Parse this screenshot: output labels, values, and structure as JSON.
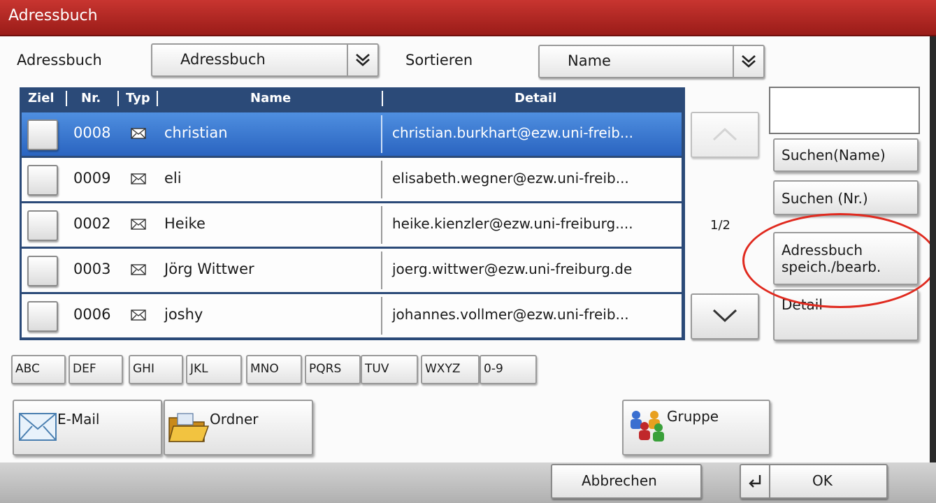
{
  "window": {
    "title": "Adressbuch"
  },
  "toolbar": {
    "addressbook_label": "Adressbuch",
    "addressbook_value": "Adressbuch",
    "sort_label": "Sortieren",
    "sort_value": "Name"
  },
  "list": {
    "headers": {
      "ziel": "Ziel",
      "nr": "Nr.",
      "typ": "Typ",
      "name": "Name",
      "detail": "Detail"
    },
    "rows": [
      {
        "nr": "0008",
        "typ": "email",
        "name": "christian",
        "detail": "christian.burkhart@ezw.uni-freib...",
        "selected": true
      },
      {
        "nr": "0009",
        "typ": "email",
        "name": "eli",
        "detail": "elisabeth.wegner@ezw.uni-freib...",
        "selected": false
      },
      {
        "nr": "0002",
        "typ": "email",
        "name": "Heike",
        "detail": "heike.kienzler@ezw.uni-freiburg....",
        "selected": false
      },
      {
        "nr": "0003",
        "typ": "email",
        "name": "Jörg Wittwer",
        "detail": "joerg.wittwer@ezw.uni-freiburg.de",
        "selected": false
      },
      {
        "nr": "0006",
        "typ": "email",
        "name": "joshy",
        "detail": "johannes.vollmer@ezw.uni-freib...",
        "selected": false
      }
    ],
    "page_indicator": "1/2"
  },
  "side": {
    "search_value": "",
    "search_name": "Suchen(Name)",
    "search_nr": "Suchen (Nr.)",
    "edit_line1": "Adressbuch",
    "edit_line2": "speich./bearb.",
    "detail": "Detail"
  },
  "alpha_keys": [
    "ABC",
    "DEF",
    "GHI",
    "JKL",
    "MNO",
    "PQRS",
    "TUV",
    "WXYZ",
    "0-9"
  ],
  "dest_types": {
    "email": "E-Mail",
    "folder": "Ordner",
    "group": "Gruppe"
  },
  "footer": {
    "cancel": "Abbrechen",
    "ok": "OK"
  },
  "colors": {
    "title_bar": "#b52824",
    "list_header": "#2b4a78",
    "selected_row": "#3a78d4",
    "annotation": "#e02a1f"
  }
}
